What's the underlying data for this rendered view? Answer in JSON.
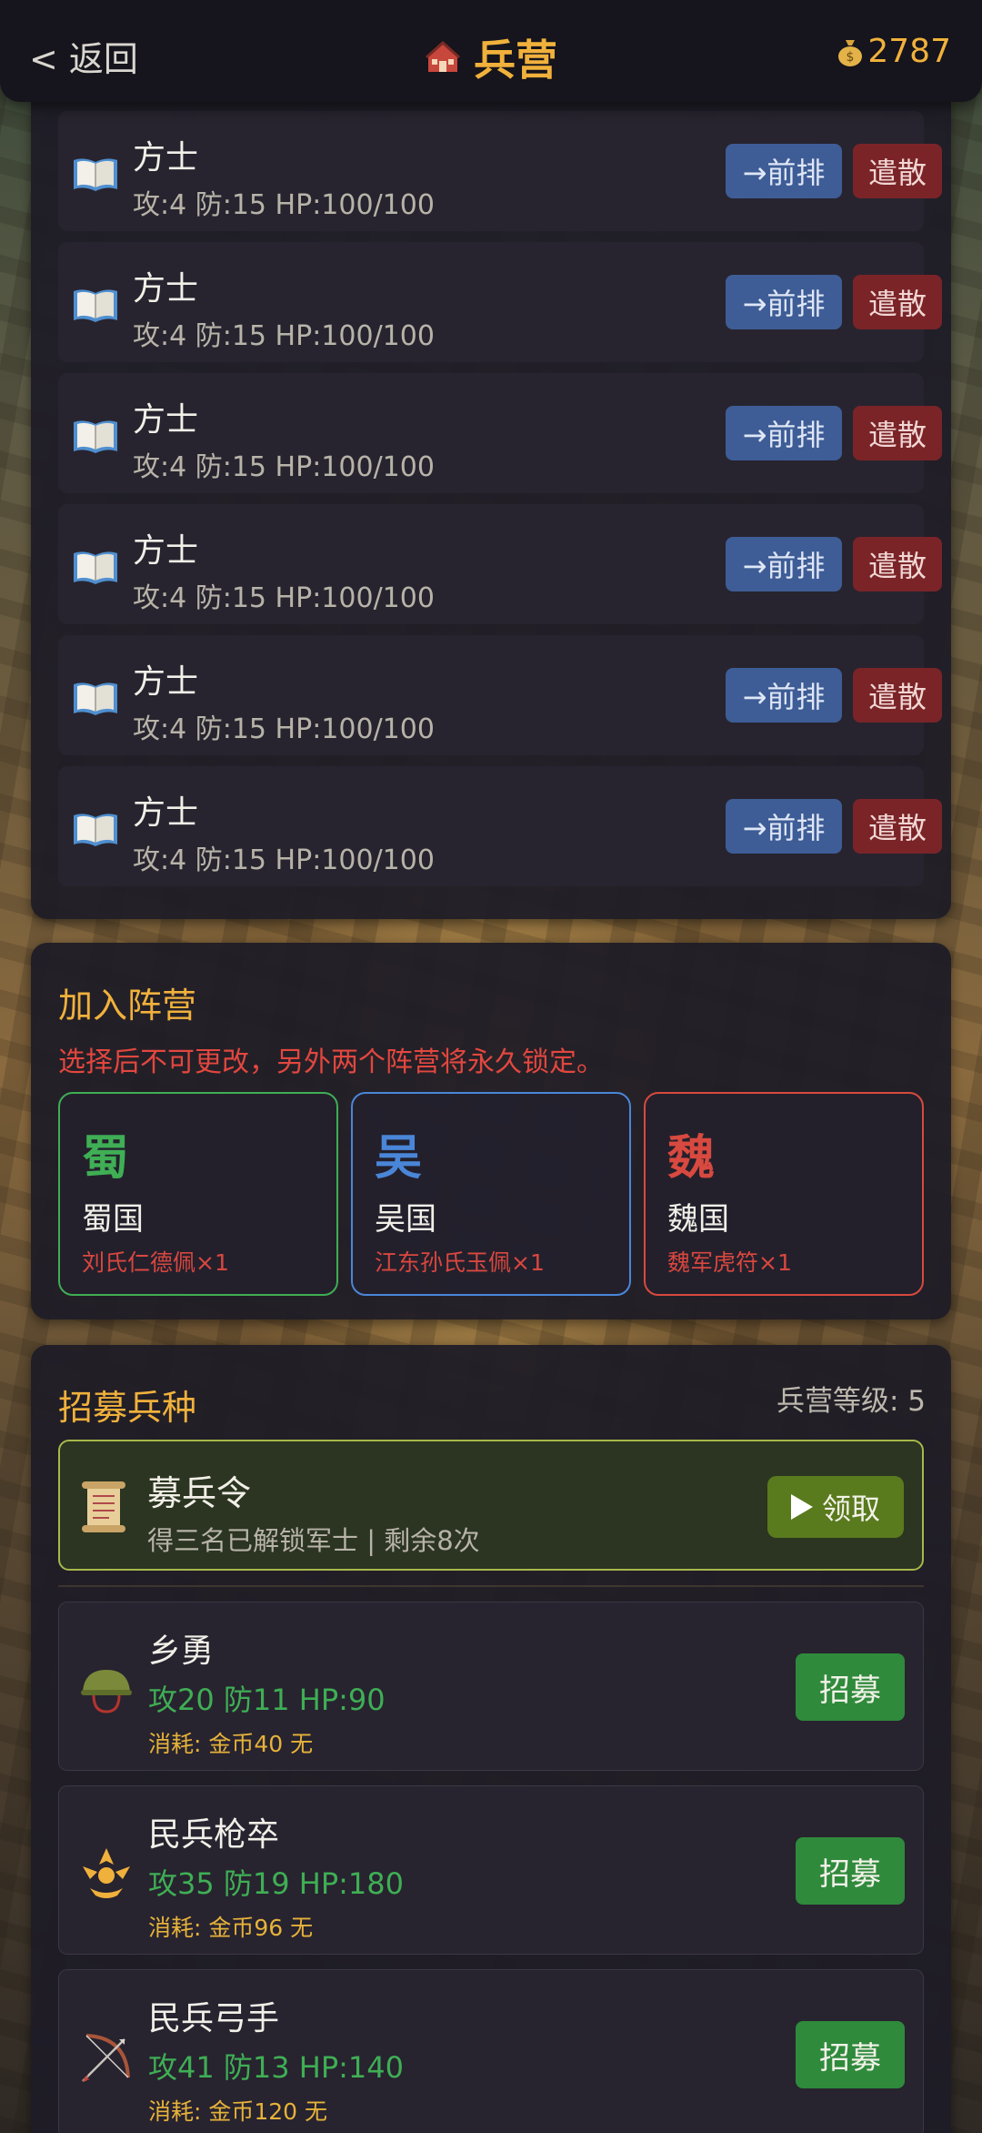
{
  "header": {
    "back_label": "< 返回",
    "title": "兵营",
    "gold": "2787"
  },
  "troops": [
    {
      "name": "方士",
      "stats": "攻:4 防:15  HP:100/100",
      "front_label": "→前排",
      "dismiss_label": "遣散",
      "icon": "book-icon"
    },
    {
      "name": "方士",
      "stats": "攻:4 防:15  HP:100/100",
      "front_label": "→前排",
      "dismiss_label": "遣散",
      "icon": "book-icon"
    },
    {
      "name": "方士",
      "stats": "攻:4 防:15  HP:100/100",
      "front_label": "→前排",
      "dismiss_label": "遣散",
      "icon": "book-icon"
    },
    {
      "name": "方士",
      "stats": "攻:4 防:15  HP:100/100",
      "front_label": "→前排",
      "dismiss_label": "遣散",
      "icon": "book-icon"
    },
    {
      "name": "方士",
      "stats": "攻:4 防:15  HP:100/100",
      "front_label": "→前排",
      "dismiss_label": "遣散",
      "icon": "book-icon"
    },
    {
      "name": "方士",
      "stats": "攻:4 防:15  HP:100/100",
      "front_label": "→前排",
      "dismiss_label": "遣散",
      "icon": "book-icon"
    }
  ],
  "faction": {
    "title": "加入阵营",
    "warning": "选择后不可更改，另外两个阵营将永久锁定。",
    "options": [
      {
        "glyph": "蜀",
        "name": "蜀国",
        "cost": "刘氏仁德佩×1",
        "color": "#3fae54"
      },
      {
        "glyph": "吴",
        "name": "吴国",
        "cost": "江东孙氏玉佩×1",
        "color": "#4a86d8"
      },
      {
        "glyph": "魏",
        "name": "魏国",
        "cost": "魏军虎符×1",
        "color": "#d8493f"
      }
    ]
  },
  "recruit": {
    "title": "招募兵种",
    "level": "兵营等级: 5",
    "order": {
      "title": "募兵令",
      "desc": "得三名已解锁军士 | 剩余8次",
      "button": "领取"
    },
    "units": [
      {
        "name": "乡勇",
        "stats": "攻20 防11 HP:90",
        "cost": "消耗: 金币40  无",
        "button": "招募",
        "icon": "helmet-icon"
      },
      {
        "name": "民兵枪卒",
        "stats": "攻35 防19 HP:180",
        "cost": "消耗: 金币96  无",
        "button": "招募",
        "icon": "spear-emblem-icon"
      },
      {
        "name": "民兵弓手",
        "stats": "攻41 防13 HP:140",
        "cost": "消耗: 金币120  无",
        "button": "招募",
        "icon": "bow-icon"
      }
    ]
  }
}
